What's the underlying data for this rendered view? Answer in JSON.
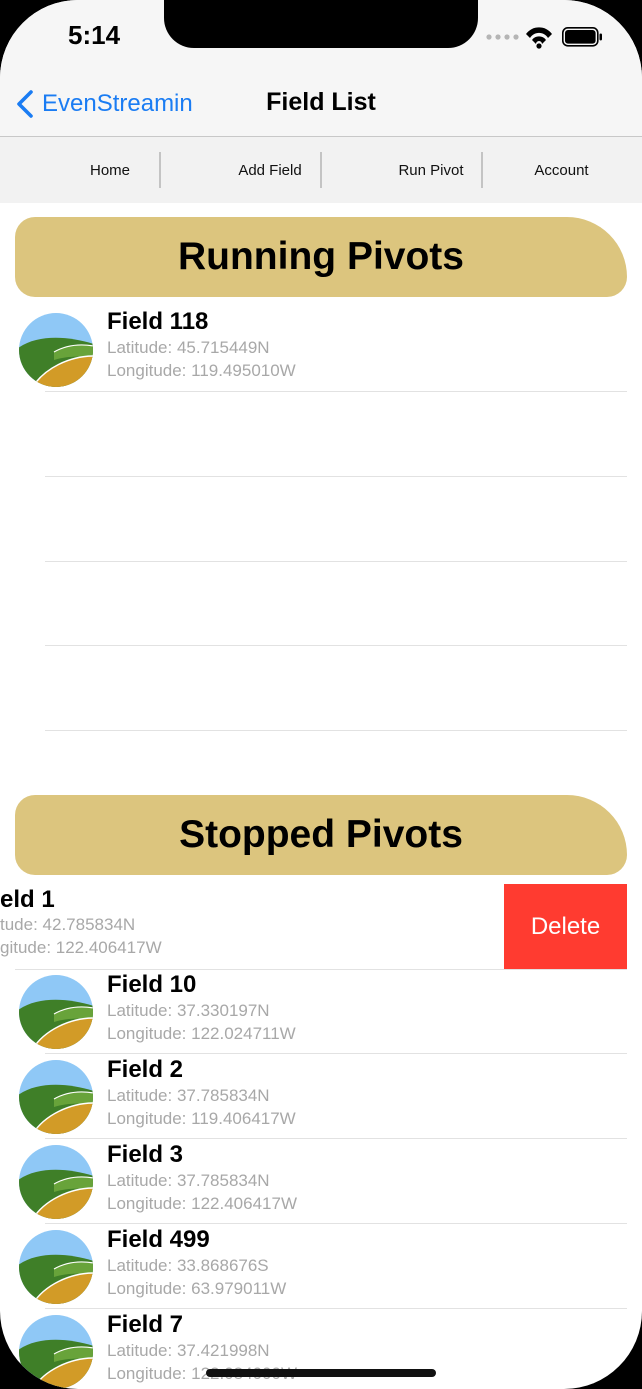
{
  "status_bar": {
    "time": "5:14",
    "icons": [
      "signal-icon",
      "wifi-icon",
      "battery-icon"
    ]
  },
  "nav": {
    "back_label": "EvenStreamin",
    "title": "Field List"
  },
  "segments": [
    "Home",
    "Add Field",
    "Run Pivot",
    "Account"
  ],
  "running": {
    "header": "Running Pivots",
    "items": [
      {
        "name": "Field 118",
        "latitude": "Latitude: 45.715449N",
        "longitude": "Longitude: 119.495010W"
      }
    ]
  },
  "stopped": {
    "header": "Stopped Pivots",
    "swiped_item": {
      "name": "eld 1",
      "latitude": "tude: 42.785834N",
      "longitude": "gitude: 122.406417W",
      "action": "Delete"
    },
    "items": [
      {
        "name": "Field 10",
        "latitude": "Latitude: 37.330197N",
        "longitude": "Longitude: 122.024711W"
      },
      {
        "name": "Field 2",
        "latitude": "Latitude: 37.785834N",
        "longitude": "Longitude: 119.406417W"
      },
      {
        "name": "Field 3",
        "latitude": "Latitude: 37.785834N",
        "longitude": "Longitude: 122.406417W"
      },
      {
        "name": "Field 499",
        "latitude": "Latitude: 33.868676S",
        "longitude": "Longitude: 63.979011W"
      },
      {
        "name": "Field 7",
        "latitude": "Latitude: 37.421998N",
        "longitude": "Longitude: 122.084000W"
      }
    ]
  },
  "colors": {
    "accent": "#1a7cf3",
    "header_bg": "#dcc57e",
    "delete": "#ff3b30"
  }
}
